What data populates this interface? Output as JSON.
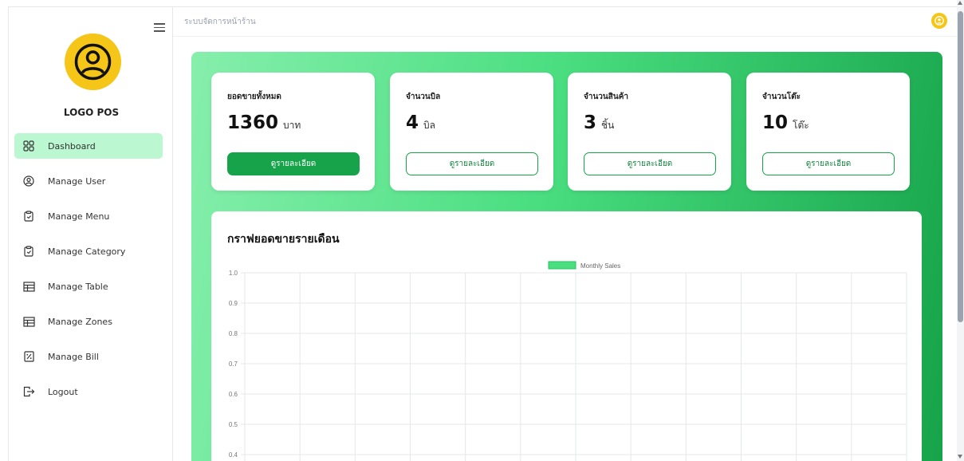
{
  "sidebar": {
    "logo_text": "LOGO POS",
    "items": [
      {
        "label": "Dashboard",
        "icon": "grid-icon",
        "active": true
      },
      {
        "label": "Manage User",
        "icon": "user-circle-icon",
        "active": false
      },
      {
        "label": "Manage Menu",
        "icon": "clipboard-icon",
        "active": false
      },
      {
        "label": "Manage Category",
        "icon": "clipboard-icon",
        "active": false
      },
      {
        "label": "Manage Table",
        "icon": "table-icon",
        "active": false
      },
      {
        "label": "Manage Zones",
        "icon": "table-icon",
        "active": false
      },
      {
        "label": "Manage Bill",
        "icon": "percent-receipt-icon",
        "active": false
      },
      {
        "label": "Logout",
        "icon": "logout-icon",
        "active": false
      }
    ]
  },
  "topbar": {
    "title": "ระบบจัดการหน้าร้าน"
  },
  "cards": [
    {
      "label": "ยอดขายทั้งหมด",
      "value": "1360",
      "unit": "บาท",
      "button": "ดูรายละเอียด",
      "filled": true
    },
    {
      "label": "จำนวนบิล",
      "value": "4",
      "unit": "บิล",
      "button": "ดูรายละเอียด",
      "filled": false
    },
    {
      "label": "จำนวนสินค้า",
      "value": "3",
      "unit": "ชิ้น",
      "button": "ดูรายละเอียด",
      "filled": false
    },
    {
      "label": "จำนวนโต๊ะ",
      "value": "10",
      "unit": "โต๊ะ",
      "button": "ดูรายละเอียด",
      "filled": false
    }
  ],
  "chart_title": "กราฟยอดขายรายเดือน",
  "colors": {
    "accent": "#16a34a",
    "sidebar_active": "#bbf7d0",
    "logo": "#f5c518",
    "bar": "#4ade80"
  },
  "chart_data": {
    "type": "bar",
    "title": "",
    "series": [
      {
        "name": "Monthly Sales",
        "values": []
      }
    ],
    "categories": [],
    "y_ticks": [
      "1.0",
      "0.9",
      "0.8",
      "0.7",
      "0.6",
      "0.5",
      "0.4"
    ],
    "ylim": [
      0.4,
      1.0
    ],
    "grid": true,
    "legend": "top-center"
  }
}
